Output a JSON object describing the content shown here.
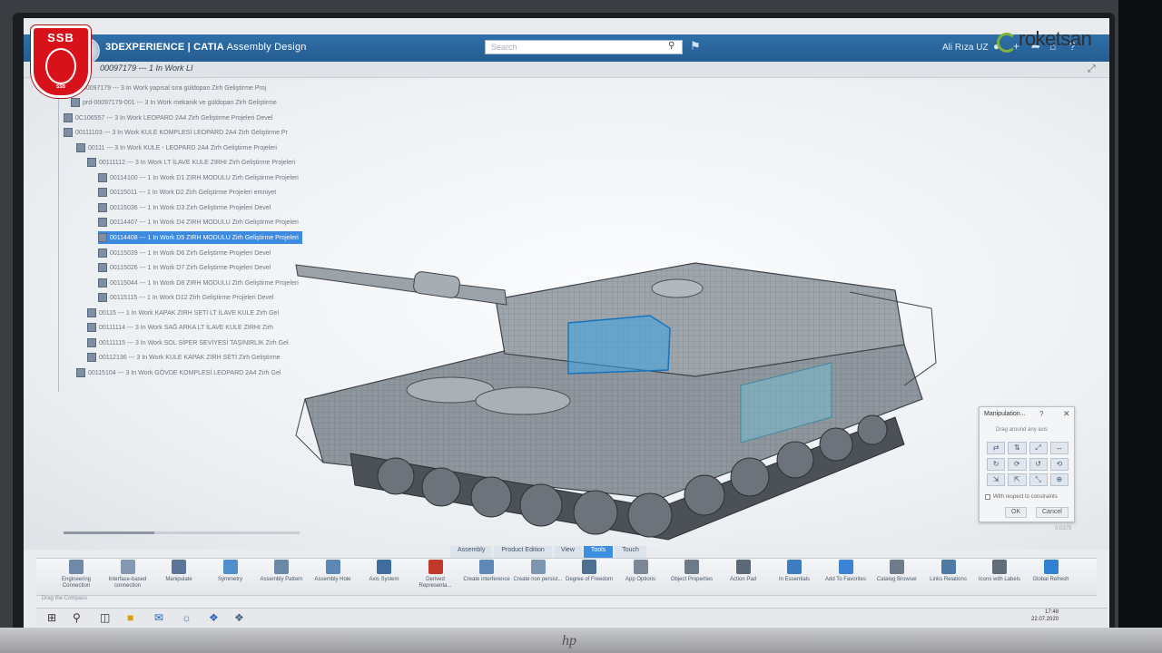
{
  "logos": {
    "ssb_text": "SSB",
    "ssb_small": "SSB",
    "roketsan": "roketsan"
  },
  "header": {
    "brand": "3DEXPERIENCE | CATIA",
    "app": "Assembly Design",
    "search_placeholder": "Search",
    "user": "Ali Rıza UZ"
  },
  "document_tab": {
    "title": "00097179 --- 1 In Work LI"
  },
  "tree": {
    "rows": [
      "00097179 --- 3 In Work yapısal sıra güldopan Zirh Geliştirme Proj",
      "prd-00097179-001 --- 3 In Work mekanik ve güldopan Zirh Geliştirme",
      "0C106557 --- 3 In Work LEOPARD 2A4 Zirh Geliştirme Projeleri Devel",
      "00111103 --- 3 In Work KULE KOMPLESİ LEOPARD 2A4 Zirh Geliştirme Pr",
      "00111 --- 3 In Work KULE - LEOPARD 2A4 Zirh Geliştirme Projeleri",
      "00111112 --- 3 In Work LT İLAVE KULE ZIRHI Zirh Geliştirme Projeleri",
      "00114100 --- 1 In Work D1 ZIRH MODULU Zirh Geliştirme Projeleri",
      "00115011 --- 1 In Work D2 Zirh Geliştirme Projeleri emniyet",
      "00115036 --- 1 In Work D3 Zirh Geliştirme Projeleri Devel",
      "00114407 --- 1 In Work D4 ZIRH MODULU Zirh Geliştirme Projeleri",
      "00114408 --- 1 In Work D5 ZIRH MODULU Zirh Geliştirme Projeleri",
      "00115039 --- 1 In Work D6 Zirh Geliştirme Projeleri Devel",
      "00115026 --- 1 In Work D7 Zirh Geliştirme Projeleri Devel",
      "00115044 --- 1 In Work D8 ZIRH MODULU Zirh Geliştirme Projeleri",
      "00115115 --- 1 In Work D12 Zirh Geliştirme Projeleri Devel",
      "00115 --- 1 In Work KAPAK ZIRH SETİ LT İLAVE KULE Zirh Gel",
      "00111114 --- 3 In Work SAĞ ARKA LT İLAVE KULE ZIRHI Zirh",
      "00111115 --- 3 In Work SOL SİPER SEVİYESİ TAŞINIRLIK Zirh Gel",
      "00112136 --- 3 In Work KULE KAPAK ZIRH SETİ Zirh Geliştirme",
      "00115104 --- 3 In Work GÖVDE KOMPLESİ LEOPARD 2A4 Zirh Gel"
    ]
  },
  "dialog": {
    "title": "Manipulation...",
    "help": "?",
    "close": "✕",
    "hint": "Drag around any axis",
    "grid": [
      "⇄",
      "⇅",
      "⤢",
      "↔",
      "↻",
      "⟳",
      "↺",
      "⟲",
      "⇲",
      "⇱",
      "⤡",
      "⊕"
    ],
    "checkbox": "With respect to constraints",
    "ok": "OK",
    "cancel": "Cancel"
  },
  "section_tabs": [
    "Assembly",
    "Product Edition",
    "View",
    "Tools",
    "Touch"
  ],
  "commands": [
    {
      "label": "Engineering Connection",
      "color": "#6f8aa8"
    },
    {
      "label": "Interface-based connection",
      "color": "#8399b2"
    },
    {
      "label": "Manipulate",
      "color": "#5a7597"
    },
    {
      "label": "Symmetry",
      "color": "#4f8fce"
    },
    {
      "label": "Assembly Pattern",
      "color": "#6c88a8"
    },
    {
      "label": "Assembly Hole",
      "color": "#5d87b5"
    },
    {
      "label": "Axis System",
      "color": "#3f6d9d"
    },
    {
      "label": "Derived Representa...",
      "color": "#c0392b"
    },
    {
      "label": "Create interference",
      "color": "#5e89b6"
    },
    {
      "label": "Create non persist...",
      "color": "#7c96b2"
    },
    {
      "label": "Degree of Freedom",
      "color": "#4d6f92"
    },
    {
      "label": "App Options",
      "color": "#7a8796"
    },
    {
      "label": "Object Properties",
      "color": "#6d7a88"
    },
    {
      "label": "Action Pad",
      "color": "#5b6877"
    },
    {
      "label": "In Essentials",
      "color": "#3e7cc0"
    },
    {
      "label": "Add To Favorites",
      "color": "#3b83d6"
    },
    {
      "label": "Catalog Browser",
      "color": "#6d7b8a"
    },
    {
      "label": "Links Relations",
      "color": "#4e79a7"
    },
    {
      "label": "Icons with Labels",
      "color": "#606d7b"
    },
    {
      "label": "Global Refresh",
      "color": "#2f82d1"
    }
  ],
  "status": {
    "text": "Drag the Compass",
    "zoom": "0.0375"
  },
  "taskbar": {
    "time": "17:48",
    "date": "22.07.2020"
  }
}
